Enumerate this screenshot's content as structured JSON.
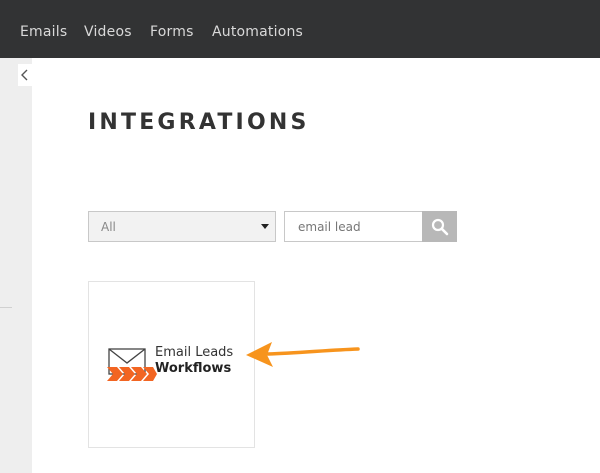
{
  "nav": {
    "items": [
      {
        "label": "Emails"
      },
      {
        "label": "Videos"
      },
      {
        "label": "Forms"
      },
      {
        "label": "Automations"
      }
    ]
  },
  "page": {
    "title": "INTEGRATIONS"
  },
  "filter": {
    "selected": "All"
  },
  "search": {
    "value": "email lead"
  },
  "results": [
    {
      "logo_line1": "Email Leads",
      "logo_line2": "Workflows"
    }
  ],
  "colors": {
    "nav_background": "#323334",
    "accent_orange": "#f7941d",
    "search_button": "#b8b8b8"
  }
}
